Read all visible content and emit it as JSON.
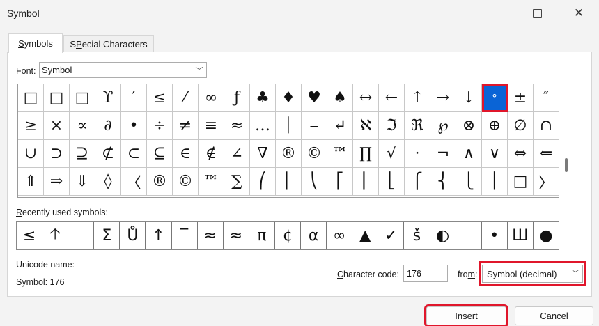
{
  "window": {
    "title": "Symbol",
    "maximize_icon": "maximize-icon",
    "close_icon": "close-icon",
    "close_glyph": "✕"
  },
  "tabs": [
    {
      "label_first": "S",
      "label_rest": "ymbols",
      "active": true
    },
    {
      "label_first": "P",
      "label_prefix": "S",
      "label_rest": "ecial Characters",
      "active": false
    }
  ],
  "font": {
    "label_underlined": "F",
    "label_rest": "ont:",
    "value": "Symbol",
    "dropdown_icon": "chevron-down-icon",
    "dropdown_glyph": "﹀"
  },
  "symbol_grid": {
    "rows": [
      [
        "□",
        "□",
        "□",
        "ϒ",
        "′",
        "≤",
        "⁄",
        "∞",
        "ƒ",
        "♣",
        "♦",
        "♥",
        "♠",
        "↔",
        "←",
        "↑",
        "→",
        "↓",
        "°",
        "±",
        "″"
      ],
      [
        "≥",
        "×",
        "∝",
        "∂",
        "•",
        "÷",
        "≠",
        "≡",
        "≈",
        "…",
        "⏐",
        "⎯",
        "↵",
        "ℵ",
        "ℑ",
        "ℜ",
        "℘",
        "⊗",
        "⊕",
        "∅",
        "∩"
      ],
      [
        "∪",
        "⊃",
        "⊇",
        "⊄",
        "⊂",
        "⊆",
        "∈",
        "∉",
        "∠",
        "∇",
        "®",
        "©",
        "™",
        "∏",
        "√",
        "⋅",
        "¬",
        "∧",
        "∨",
        "⇔",
        "⇐"
      ],
      [
        "⇑",
        "⇒",
        "⇓",
        "◊",
        "〈",
        "®",
        "©",
        "™",
        "∑",
        "⎛",
        "⎜",
        "⎝",
        "⎡",
        "⎢",
        "⎣",
        "⎧",
        "⎨",
        "⎩",
        "⎪",
        "□",
        "〉"
      ]
    ],
    "selected_row": 0,
    "selected_col": 18
  },
  "recent": {
    "label_underlined": "R",
    "label_rest": "ecently used symbols:",
    "symbols": [
      "≤",
      "🡡",
      "",
      "Σ",
      "Ů",
      "↑",
      "‾",
      "≈",
      "≈",
      "π",
      "¢",
      "α",
      "∞",
      "▲",
      "✓",
      "š",
      "◐",
      "",
      "•",
      "Ш",
      "●"
    ]
  },
  "unicode_name": {
    "label": "Unicode name:",
    "value": "Symbol: 176"
  },
  "character_code": {
    "label_underlined": "C",
    "label_rest": "haracter code:",
    "value": "176"
  },
  "from": {
    "label_prefix": "fro",
    "label_underlined": "m",
    "label_rest": ":",
    "value": "Symbol (decimal)",
    "dropdown_glyph": "﹀"
  },
  "buttons": {
    "insert": {
      "label_underlined": "I",
      "label_rest": "nsert"
    },
    "cancel": "Cancel"
  },
  "colors": {
    "selected_cell": "#0a64d6",
    "highlight": "#e0162b"
  }
}
